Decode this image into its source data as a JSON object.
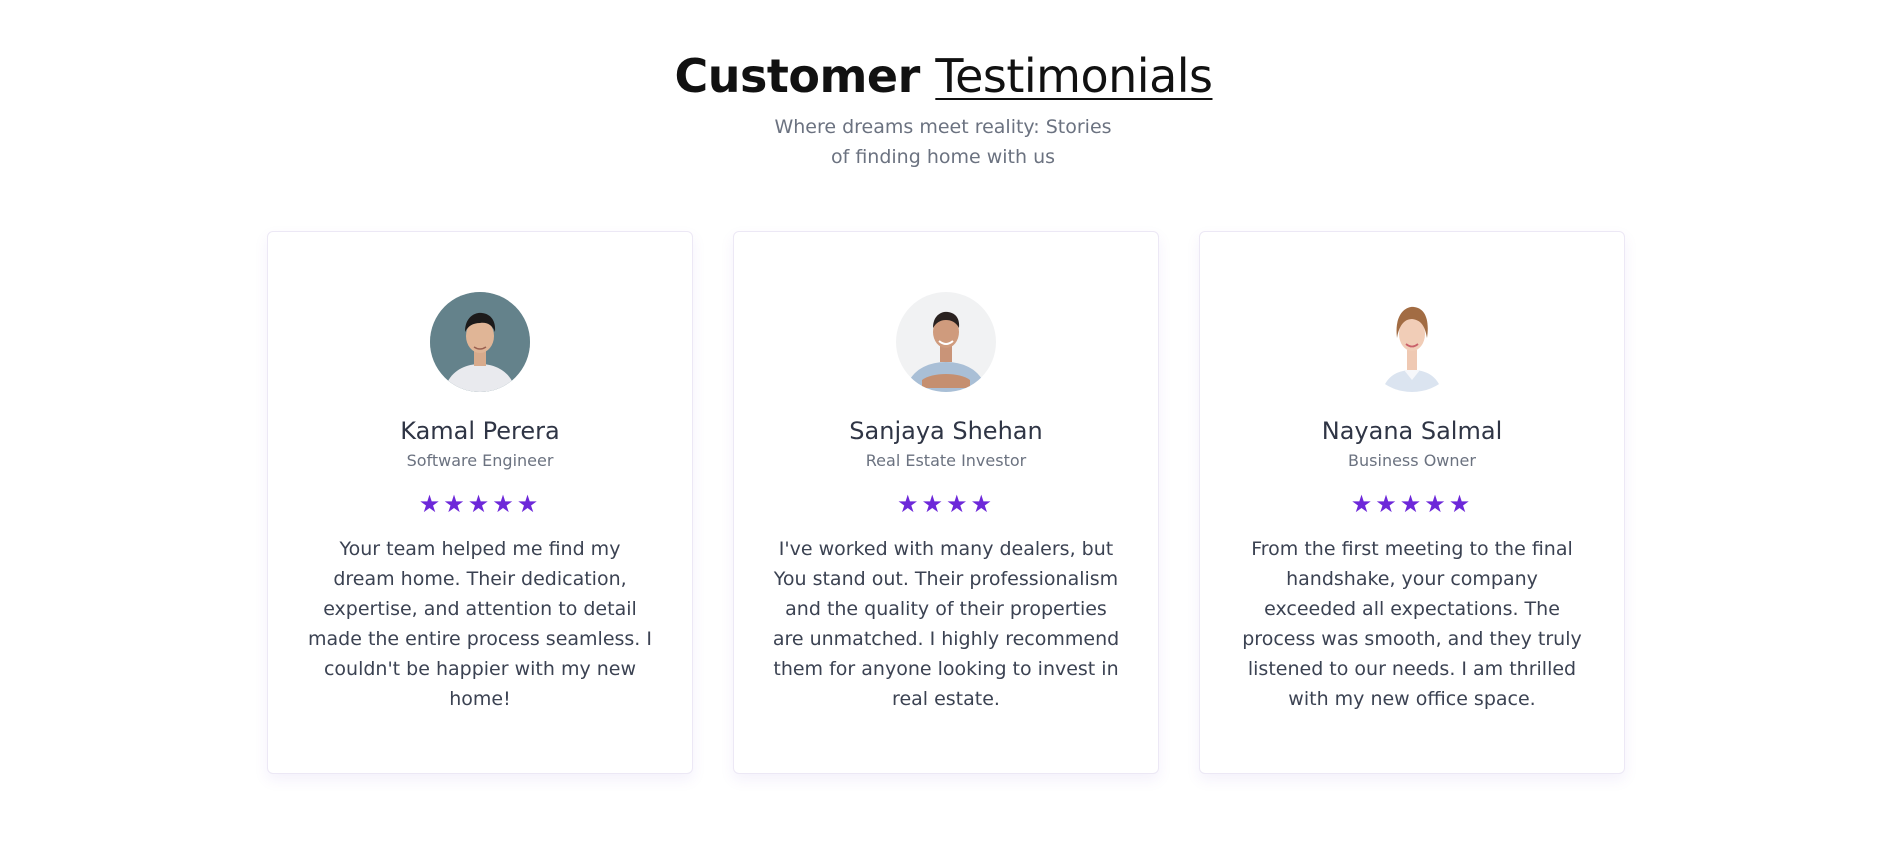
{
  "header": {
    "title_strong": "Customer",
    "title_underlined": "Testimonials",
    "subtitle": "Where dreams meet reality: Stories of finding home with us"
  },
  "testimonials": [
    {
      "name": "Kamal Perera",
      "role": "Software Engineer",
      "rating": 5,
      "quote": "Your team helped me find my dream home. Their dedication, expertise, and attention to detail made the entire process seamless. I couldn't be happier with my new home!"
    },
    {
      "name": "Sanjaya Shehan",
      "role": "Real Estate Investor",
      "rating": 4,
      "quote": "I've worked with many dealers, but You stand out. Their professionalism and the quality of their properties are unmatched. I highly recommend them for anyone looking to invest in real estate."
    },
    {
      "name": "Nayana Salmal",
      "role": "Business Owner",
      "rating": 5,
      "quote": "From the first meeting to the final handshake, your company exceeded all expectations. The process was smooth, and they truly listened to our needs. I am thrilled with my new office space."
    }
  ],
  "colors": {
    "star": "#6d28d9",
    "heading": "#111111",
    "muted": "#6b7280"
  },
  "icons": {
    "star": "star-icon"
  }
}
